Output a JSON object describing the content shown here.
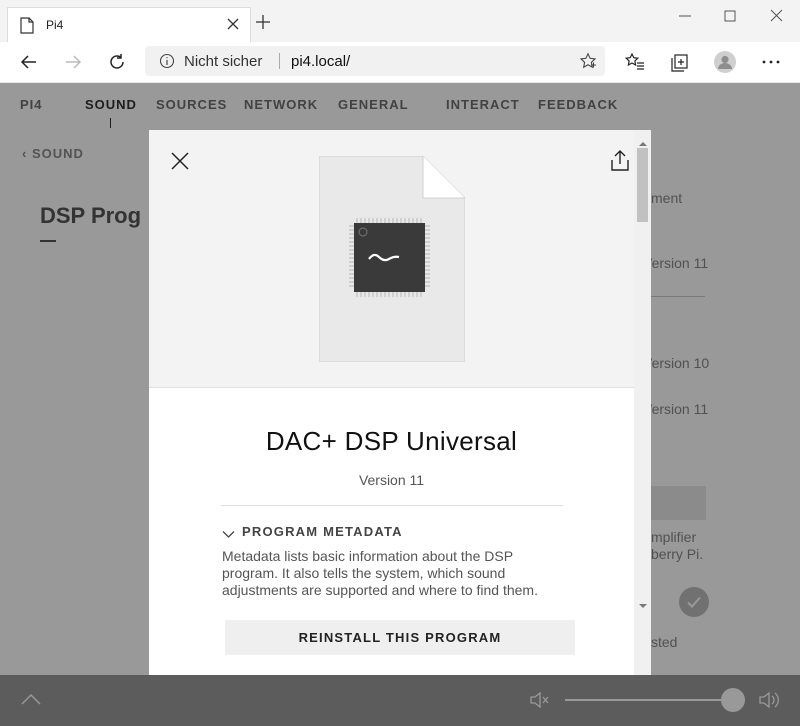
{
  "browser": {
    "tab_title": "Pi4",
    "security_label": "Nicht sicher",
    "url": "pi4.local/"
  },
  "page": {
    "nav": {
      "brand": "PI4",
      "items": [
        "SOUND",
        "SOURCES",
        "NETWORK",
        "GENERAL",
        "INTERACT",
        "FEEDBACK"
      ],
      "active": "SOUND"
    },
    "back_label": "SOUND",
    "title": "DSP Prog",
    "side_items": [
      "ment",
      "Version 11",
      "Version 10",
      "Version 11",
      "mplifier",
      "berry Pi.",
      "sted"
    ]
  },
  "modal": {
    "title": "DAC+ DSP Universal",
    "version": "Version 11",
    "metadata_label": "PROGRAM METADATA",
    "metadata_text": "Metadata lists basic information about the DSP program. It also tells the system, which sound adjustments are supported and where to find them.",
    "reinstall_label": "REINSTALL THIS PROGRAM"
  },
  "colors": {
    "overlay": "#000000",
    "modal_background": "#ffffff",
    "header_background": "#f3f3f3",
    "chip": "#3a3a3a"
  },
  "icons": [
    "document-icon",
    "close-tab-icon",
    "new-tab-icon",
    "minimize-icon",
    "maximize-icon",
    "close-window-icon",
    "back-icon",
    "forward-icon",
    "refresh-icon",
    "info-icon",
    "favorite-star-icon",
    "favorites-icon",
    "collections-icon",
    "profile-icon",
    "more-icon",
    "close-icon",
    "share-icon",
    "dsp-chip-icon",
    "chevron-down-icon"
  ]
}
